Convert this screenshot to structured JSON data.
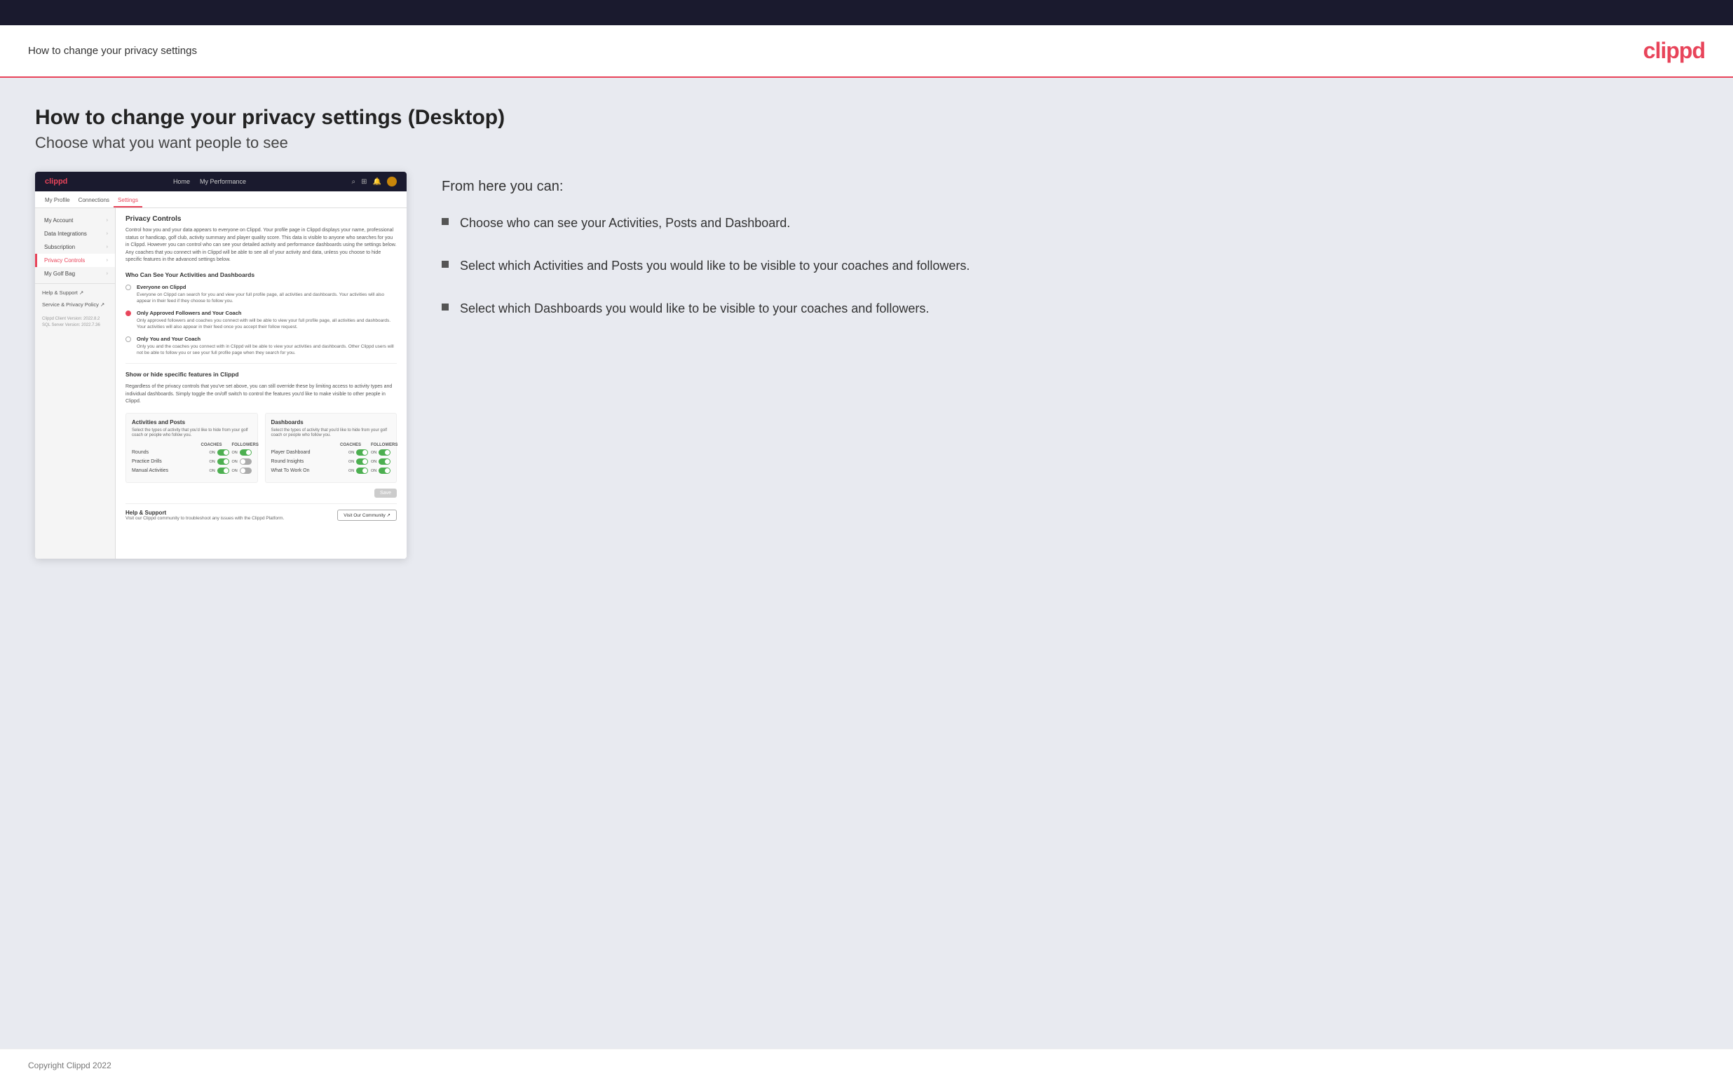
{
  "header": {
    "title": "How to change your privacy settings",
    "logo": "clippd"
  },
  "page": {
    "heading": "How to change your privacy settings (Desktop)",
    "subheading": "Choose what you want people to see"
  },
  "right_panel": {
    "from_here_label": "From here you can:",
    "bullets": [
      "Choose who can see your Activities, Posts and Dashboard.",
      "Select which Activities and Posts you would like to be visible to your coaches and followers.",
      "Select which Dashboards you would like to be visible to your coaches and followers."
    ]
  },
  "app_screenshot": {
    "nav": {
      "brand": "clippd",
      "links": [
        "Home",
        "My Performance"
      ],
      "icons": [
        "search",
        "grid",
        "bell",
        "avatar"
      ]
    },
    "subnav": {
      "items": [
        "My Profile",
        "Connections",
        "Settings"
      ],
      "active": "Settings"
    },
    "sidebar": {
      "items": [
        {
          "label": "My Account",
          "active": false,
          "has_chevron": true
        },
        {
          "label": "Data Integrations",
          "active": false,
          "has_chevron": true
        },
        {
          "label": "Subscription",
          "active": false,
          "has_chevron": true
        },
        {
          "label": "Privacy Controls",
          "active": true,
          "has_chevron": true
        },
        {
          "label": "My Golf Bag",
          "active": false,
          "has_chevron": true
        }
      ],
      "links": [
        "Help & Support ↗",
        "Service & Privacy Policy ↗"
      ],
      "version": "Clippd Client Version: 2022.8.2\nSQL Server Version: 2022.7.36"
    },
    "main": {
      "privacy_title": "Privacy Controls",
      "privacy_desc": "Control how you and your data appears to everyone on Clippd. Your profile page in Clippd displays your name, professional status or handicap, golf club, activity summary and player quality score. This data is visible to anyone who searches for you in Clippd. However you can control who can see your detailed activity and performance dashboards using the settings below. Any coaches that you connect with in Clippd will be able to see all of your activity and data, unless you choose to hide specific features in the advanced settings below.",
      "section1_title": "Who Can See Your Activities and Dashboards",
      "radio_options": [
        {
          "label": "Everyone on Clippd",
          "desc": "Everyone on Clippd can search for you and view your full profile page, all activities and dashboards. Your activities will also appear in their feed if they choose to follow you.",
          "selected": false
        },
        {
          "label": "Only Approved Followers and Your Coach",
          "desc": "Only approved followers and coaches you connect with will be able to view your full profile page, all activities and dashboards. Your activities will also appear in their feed once you accept their follow request.",
          "selected": true
        },
        {
          "label": "Only You and Your Coach",
          "desc": "Only you and the coaches you connect with in Clippd will be able to view your activities and dashboards. Other Clippd users will not be able to follow you or see your full profile page when they search for you.",
          "selected": false
        }
      ],
      "section2_title": "Show or hide specific features in Clippd",
      "section2_desc": "Regardless of the privacy controls that you've set above, you can still override these by limiting access to activity types and individual dashboards. Simply toggle the on/off switch to control the features you'd like to make visible to other people in Clippd.",
      "activities_title": "Activities and Posts",
      "activities_desc": "Select the types of activity that you'd like to hide from your golf coach or people who follow you.",
      "activity_rows": [
        {
          "label": "Rounds",
          "coaches": "on",
          "followers": "on"
        },
        {
          "label": "Practice Drills",
          "coaches": "on",
          "followers": "off"
        },
        {
          "label": "Manual Activities",
          "coaches": "on",
          "followers": "off"
        }
      ],
      "dashboards_title": "Dashboards",
      "dashboards_desc": "Select the types of activity that you'd like to hide from your golf coach or people who follow you.",
      "dashboard_rows": [
        {
          "label": "Player Dashboard",
          "coaches": "on",
          "followers": "on"
        },
        {
          "label": "Round Insights",
          "coaches": "on",
          "followers": "on"
        },
        {
          "label": "What To Work On",
          "coaches": "on",
          "followers": "on"
        }
      ],
      "save_label": "Save",
      "help_title": "Help & Support",
      "help_desc": "Visit our Clippd community to troubleshoot any issues with the Clippd Platform.",
      "visit_label": "Visit Our Community ↗"
    }
  },
  "footer": {
    "text": "Copyright Clippd 2022"
  }
}
